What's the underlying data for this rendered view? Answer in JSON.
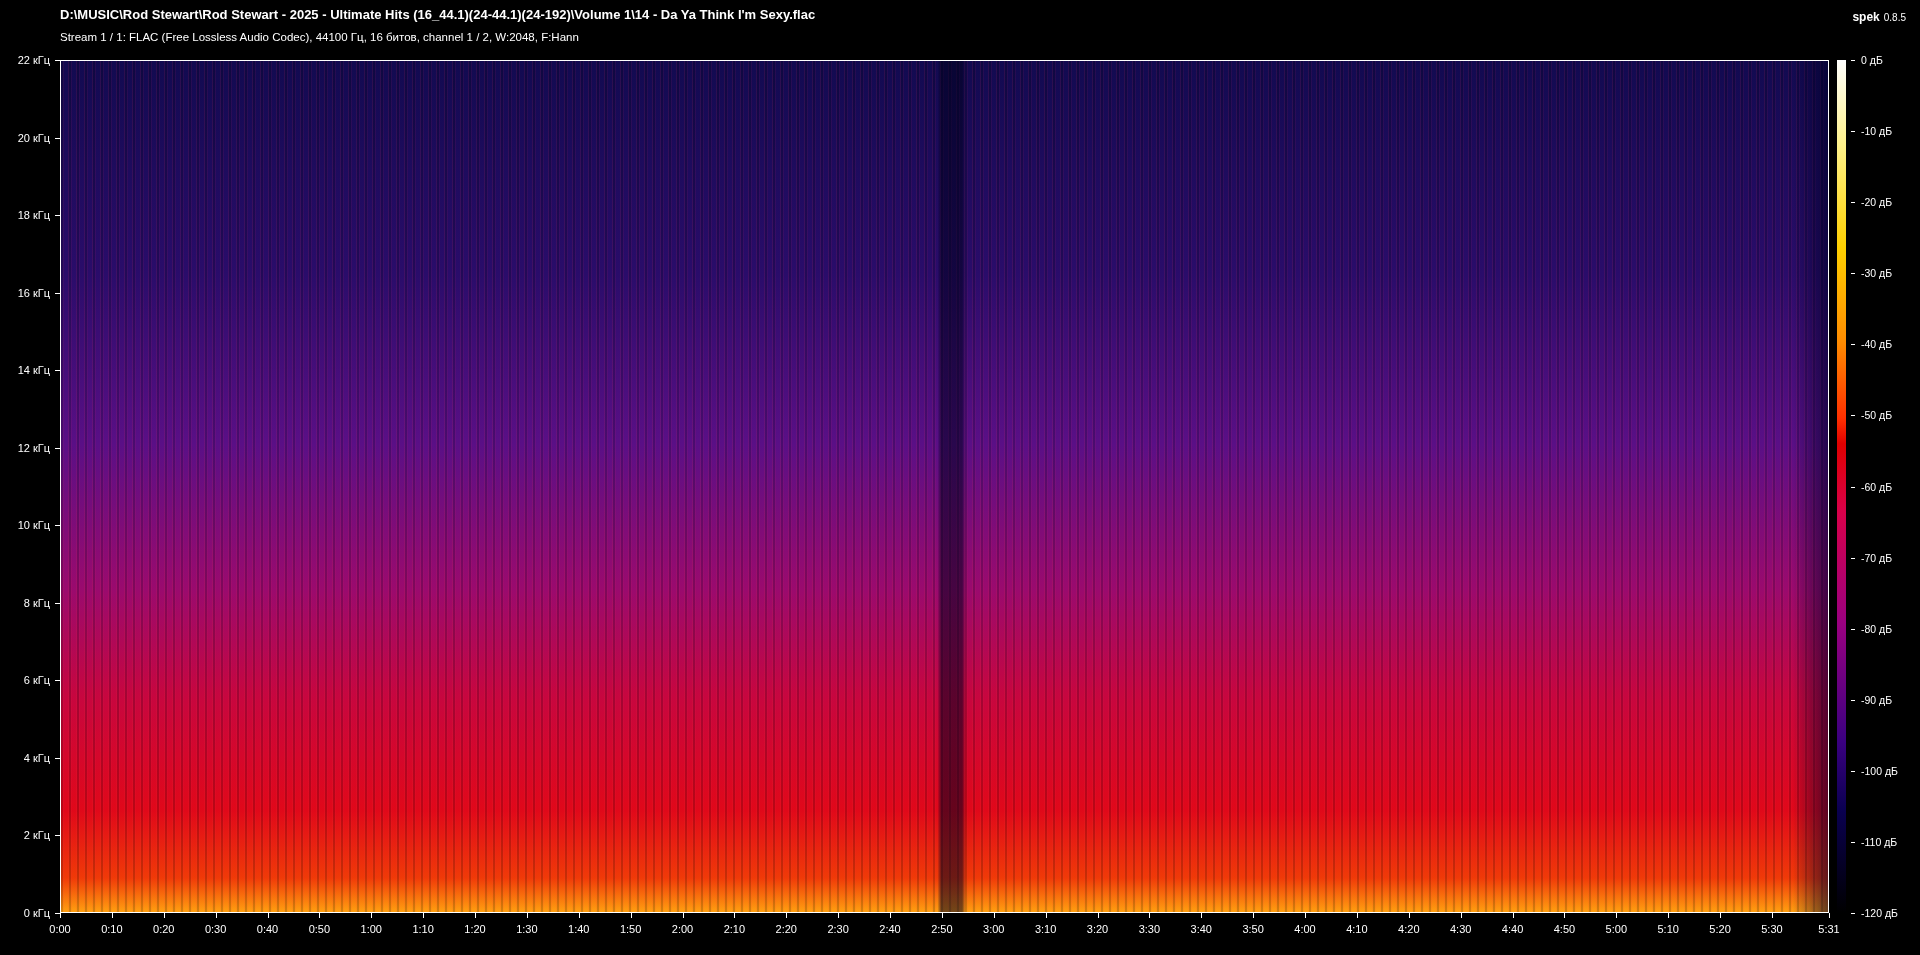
{
  "header": {
    "file_path": "D:\\MUSIC\\Rod Stewart\\Rod Stewart - 2025 - Ultimate Hits (16_44.1)(24-44.1)(24-192)\\Volume 1\\14 - Da Ya Think I'm Sexy.flac",
    "stream_info": "Stream 1 / 1: FLAC (Free Lossless Audio Codec), 44100 Гц, 16 битов, channel 1 / 2, W:2048, F:Hann"
  },
  "app": {
    "name": "spek",
    "version": "0.8.5"
  },
  "spectrogram": {
    "frequency_ticks": [
      "22 кГц",
      "20 кГц",
      "18 кГц",
      "16 кГц",
      "14 кГц",
      "12 кГц",
      "10 кГц",
      "8 кГц",
      "6 кГц",
      "4 кГц",
      "2 кГц",
      "0 кГц"
    ],
    "time_ticks": [
      "0:00",
      "0:10",
      "0:20",
      "0:30",
      "0:40",
      "0:50",
      "1:00",
      "1:10",
      "1:20",
      "1:30",
      "1:40",
      "1:50",
      "2:00",
      "2:10",
      "2:20",
      "2:30",
      "2:40",
      "2:50",
      "3:00",
      "3:10",
      "3:20",
      "3:30",
      "3:40",
      "3:50",
      "4:00",
      "4:10",
      "4:20",
      "4:30",
      "4:40",
      "4:50",
      "5:00",
      "5:10",
      "5:20",
      "5:30",
      "5:31"
    ]
  },
  "color_scale": {
    "ticks": [
      "0 дБ",
      "-10 дБ",
      "-20 дБ",
      "-30 дБ",
      "-40 дБ",
      "-50 дБ",
      "-60 дБ",
      "-70 дБ",
      "-80 дБ",
      "-90 дБ",
      "-100 дБ",
      "-110 дБ",
      "-120 дБ"
    ]
  }
}
